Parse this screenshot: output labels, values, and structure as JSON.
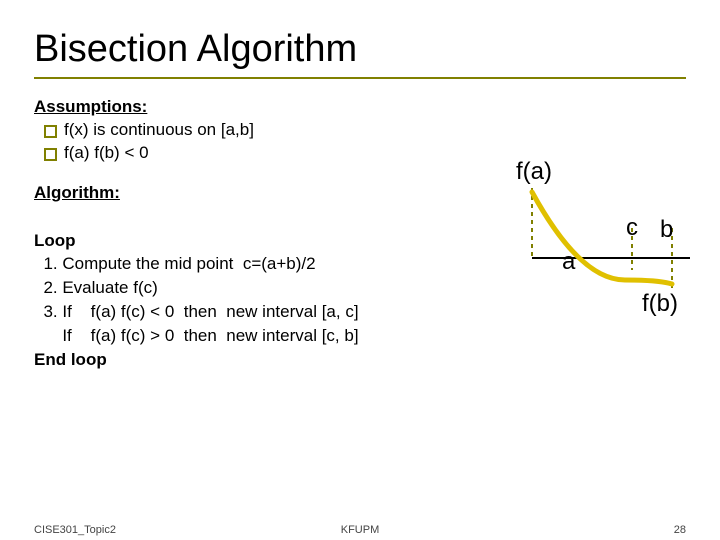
{
  "title": "Bisection Algorithm",
  "assumptions": {
    "heading": "Assumptions:",
    "items": [
      "f(x) is continuous on [a,b]",
      "f(a) f(b) < 0"
    ]
  },
  "algorithm": {
    "heading": "Algorithm:",
    "loop_open": "Loop",
    "step1": "  1. Compute the mid point  c=(a+b)/2",
    "step2": "  2. Evaluate f(c)",
    "step3a": "  3. If    f(a) f(c) < 0  then  new interval [a, c]",
    "step3b": "      If    f(a) f(c) > 0  then  new interval [c, b]",
    "loop_close": "End loop"
  },
  "diagram": {
    "fa": "f(a)",
    "a": "a",
    "c": "c",
    "b": "b",
    "fb": "f(b)"
  },
  "footer": {
    "left": "CISE301_Topic2",
    "center": "KFUPM",
    "page": "28"
  }
}
